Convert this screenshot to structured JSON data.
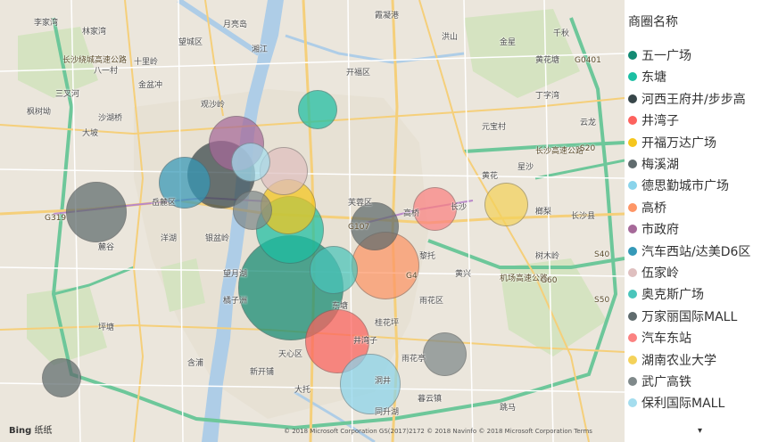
{
  "legend": {
    "title": "商圈名称",
    "scroll_icon": "chevron-down-icon",
    "items": [
      {
        "label": "五一广场",
        "color": "#138a73"
      },
      {
        "label": "东塘",
        "color": "#1cbfa3"
      },
      {
        "label": "河西王府井/步步高",
        "color": "#374649"
      },
      {
        "label": "井湾子",
        "color": "#fd625e"
      },
      {
        "label": "开福万达广场",
        "color": "#f5c61d"
      },
      {
        "label": "梅溪湖",
        "color": "#5f6b6d"
      },
      {
        "label": "德思勤城市广场",
        "color": "#8ad4eb"
      },
      {
        "label": "高桥",
        "color": "#fe9666"
      },
      {
        "label": "市政府",
        "color": "#a66999"
      },
      {
        "label": "汽车西站/达美D6区",
        "color": "#3599b8"
      },
      {
        "label": "伍家岭",
        "color": "#dfbfbf"
      },
      {
        "label": "奥克斯广场",
        "color": "#4ac5bb"
      },
      {
        "label": "万家丽国际MALL",
        "color": "#5f6b6d"
      },
      {
        "label": "汽车东站",
        "color": "#fb8281"
      },
      {
        "label": "湖南农业大学",
        "color": "#f4d25a"
      },
      {
        "label": "武广高铁",
        "color": "#7f898a"
      },
      {
        "label": "保利国际MALL",
        "color": "#a4ddee"
      }
    ]
  },
  "map": {
    "attribution": "© 2018 Microsoft Corporation   GS(2017)2172 © 2018 Navinfo © 2018 Microsoft Corporation Terms",
    "logo_text": "Bing",
    "logo_sub": "纸纸",
    "bubbles": [
      {
        "category": "五一广场",
        "size": 1.0
      },
      {
        "category": "东塘",
        "size": 0.55
      },
      {
        "category": "河西王府井/步步高",
        "size": 0.55
      },
      {
        "category": "井湾子",
        "size": 0.5
      },
      {
        "category": "开福万达广场",
        "size": 0.4
      },
      {
        "category": "梅溪湖",
        "size": 0.45
      },
      {
        "category": "德思勤城市广场",
        "size": 0.45
      },
      {
        "category": "高桥",
        "size": 0.55
      },
      {
        "category": "市政府",
        "size": 0.4
      },
      {
        "category": "汽车西站/达美D6区",
        "size": 0.35
      },
      {
        "category": "伍家岭",
        "size": 0.3
      },
      {
        "category": "奥克斯广场",
        "size": 0.3
      },
      {
        "category": "万家丽国际MALL",
        "size": 0.3
      },
      {
        "category": "汽车东站",
        "size": 0.25
      },
      {
        "category": "湖南农业大学",
        "size": 0.25
      },
      {
        "category": "武广高铁",
        "size": 0.25
      },
      {
        "category": "保利国际MALL",
        "size": 0.2
      },
      {
        "category": "东塘",
        "size": 0.2
      },
      {
        "category": "万家丽国际MALL",
        "size": 0.2
      },
      {
        "category": "武广高铁",
        "size": 0.2
      }
    ],
    "labels": [
      {
        "text": "李家湾"
      },
      {
        "text": "林家湾"
      },
      {
        "text": "八一村"
      },
      {
        "text": "十里岭"
      },
      {
        "text": "三叉河"
      },
      {
        "text": "沙湖桥"
      },
      {
        "text": "金盆冲"
      },
      {
        "text": "枫树坳"
      },
      {
        "text": "大坡"
      },
      {
        "text": "湘江"
      },
      {
        "text": "开福区"
      },
      {
        "text": "霞凝港"
      },
      {
        "text": "洪山"
      },
      {
        "text": "丁字湾"
      },
      {
        "text": "黄花塘"
      },
      {
        "text": "千秋"
      },
      {
        "text": "云龙"
      },
      {
        "text": "元宝村"
      },
      {
        "text": "长沙"
      },
      {
        "text": "高桥"
      },
      {
        "text": "井湾子"
      },
      {
        "text": "东塘"
      },
      {
        "text": "雨花区"
      },
      {
        "text": "天心区"
      },
      {
        "text": "岳麓区"
      },
      {
        "text": "芙蓉区"
      },
      {
        "text": "望城区"
      },
      {
        "text": "黎托"
      },
      {
        "text": "月亮岛"
      },
      {
        "text": "金星"
      },
      {
        "text": "暮云镇"
      },
      {
        "text": "含浦"
      },
      {
        "text": "坪塘"
      },
      {
        "text": "洞井"
      },
      {
        "text": "黄兴"
      },
      {
        "text": "榔梨"
      },
      {
        "text": "星沙"
      },
      {
        "text": "长沙县"
      },
      {
        "text": "黄花"
      },
      {
        "text": "跳马"
      },
      {
        "text": "大托"
      },
      {
        "text": "新开铺"
      },
      {
        "text": "桂花坪"
      },
      {
        "text": "雨花亭"
      },
      {
        "text": "树木岭"
      },
      {
        "text": "同升湖"
      },
      {
        "text": "洋湖"
      },
      {
        "text": "麓谷"
      },
      {
        "text": "观沙岭"
      },
      {
        "text": "银盆岭"
      },
      {
        "text": "望月湖"
      },
      {
        "text": "橘子洲"
      },
      {
        "text": "长沙高速公路"
      },
      {
        "text": "长沙绕城高速公路"
      },
      {
        "text": "机场高速公路"
      },
      {
        "text": "G60"
      },
      {
        "text": "G4"
      },
      {
        "text": "G319"
      },
      {
        "text": "G107"
      },
      {
        "text": "S20"
      },
      {
        "text": "S40"
      },
      {
        "text": "S50"
      },
      {
        "text": "G0401"
      }
    ]
  }
}
